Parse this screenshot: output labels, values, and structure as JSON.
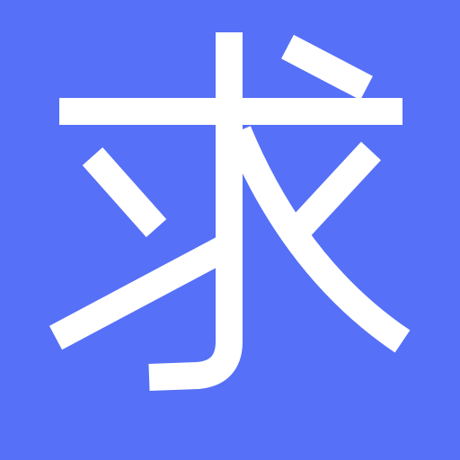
{
  "icon": {
    "character": "求",
    "background_color": "#5670F7",
    "glyph_color": "#FFFFFF"
  }
}
